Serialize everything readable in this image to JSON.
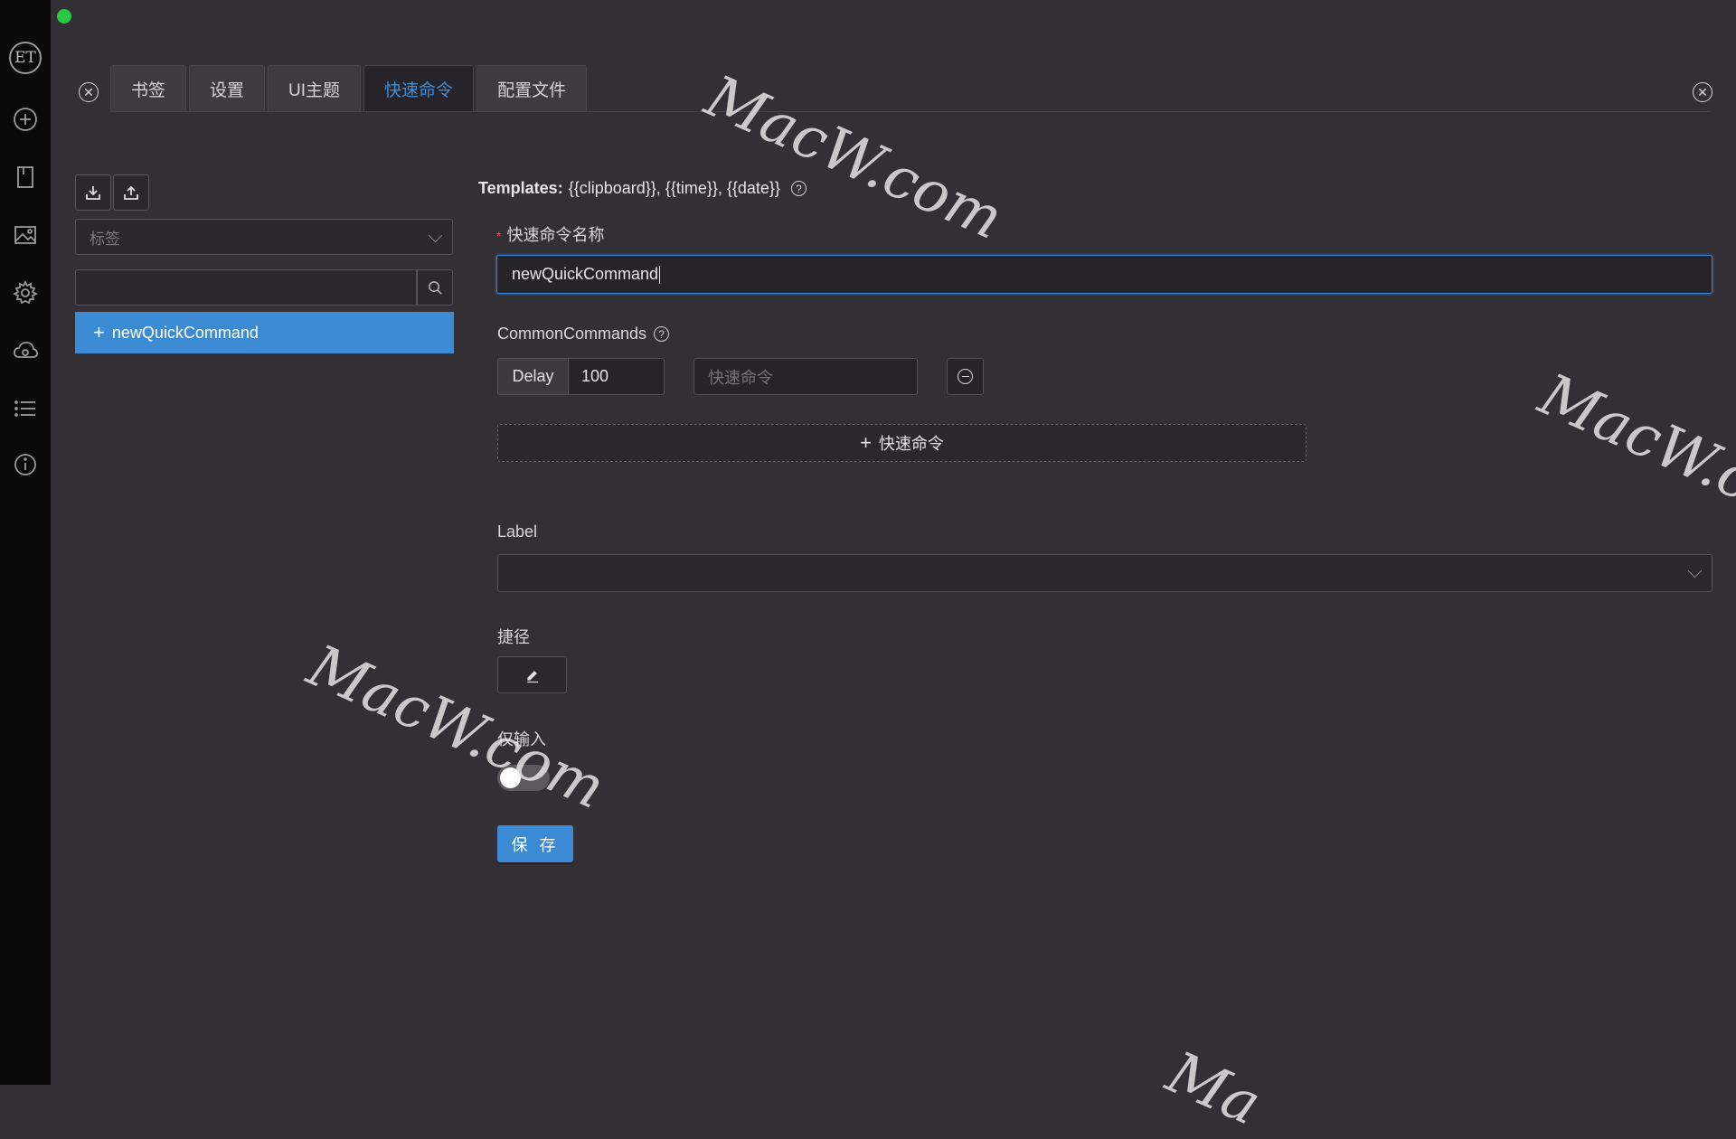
{
  "window": {
    "traffic_lights": [
      "#fe5f57",
      "#febc2e",
      "#28c840"
    ]
  },
  "sidebar": {
    "logo_text": "ET",
    "items": [
      {
        "name": "new-tab-icon"
      },
      {
        "name": "bookmark-icon"
      },
      {
        "name": "image-icon"
      },
      {
        "name": "gear-icon"
      },
      {
        "name": "cloud-icon"
      },
      {
        "name": "list-icon"
      },
      {
        "name": "info-icon"
      }
    ]
  },
  "tabs": [
    {
      "label": "书签",
      "active": false
    },
    {
      "label": "设置",
      "active": false
    },
    {
      "label": "UI主题",
      "active": false
    },
    {
      "label": "快速命令",
      "active": true
    },
    {
      "label": "配置文件",
      "active": false
    }
  ],
  "left_panel": {
    "tag_select_placeholder": "标签",
    "search_value": "",
    "items": [
      {
        "label": "newQuickCommand",
        "selected": true
      }
    ]
  },
  "form": {
    "templates_label": "Templates:",
    "templates_text": "{{clipboard}}, {{time}}, {{date}}",
    "name_label": "快速命令名称",
    "name_value": "newQuickCommand",
    "common_commands_label": "CommonCommands",
    "delay_addon": "Delay",
    "delay_value": "100",
    "command_placeholder": "快速命令",
    "add_command_label": "快速命令",
    "label_label": "Label",
    "label_value": "",
    "shortcut_label": "捷径",
    "input_only_label": "仅输入",
    "input_only_enabled": false,
    "save_label": "保 存"
  },
  "watermarks": [
    "MacW.com",
    "MacW.com",
    "MacW.com",
    "Ma"
  ],
  "colors": {
    "accent": "#3a8bd3",
    "background": "#322f35",
    "sidebar": "#0a0a0a"
  }
}
